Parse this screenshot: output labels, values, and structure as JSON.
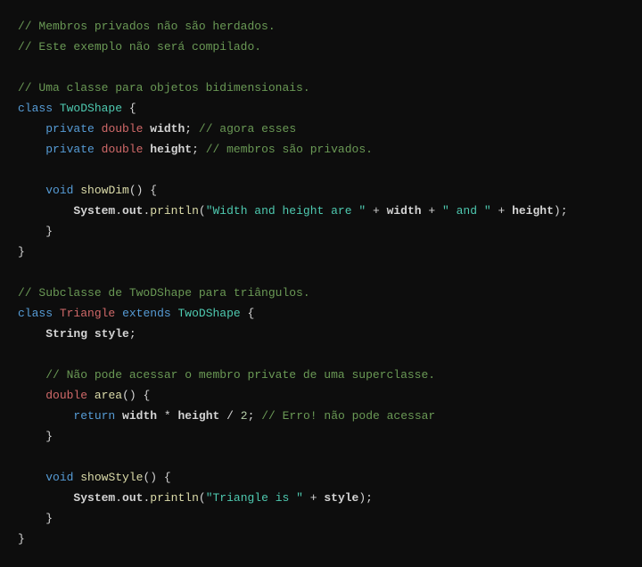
{
  "code": {
    "comments": {
      "c1": "// Membros privados não são herdados.",
      "c2": "// Este exemplo não será compilado.",
      "c3": "// Uma classe para objetos bidimensionais.",
      "c4": "// agora esses",
      "c5": "// membros são privados.",
      "c6": "// Subclasse de TwoDShape para triângulos.",
      "c7": "// Não pode acessar o membro private de uma superclasse.",
      "c8": "// Erro! não pode acessar"
    },
    "kw": {
      "class": "class",
      "private": "private",
      "double": "double",
      "void": "void",
      "extends": "extends",
      "return": "return"
    },
    "types": {
      "String": "String"
    },
    "names": {
      "TwoDShape": "TwoDShape",
      "Triangle": "Triangle",
      "width": "width",
      "height": "height",
      "style": "style",
      "System": "System",
      "out": "out",
      "println": "println",
      "showDim": "showDim",
      "area": "area",
      "showStyle": "showStyle"
    },
    "strings": {
      "s1": "\"Width and height are \"",
      "s2": "\" and \"",
      "s3": "\"Triangle is \""
    },
    "nums": {
      "two": "2"
    },
    "punct": {
      "lbrace": "{",
      "rbrace": "}",
      "lparen": "(",
      "rparen": ")",
      "semi": ";",
      "plus": "+",
      "star": "*",
      "slash": "/",
      "dot": "."
    }
  }
}
